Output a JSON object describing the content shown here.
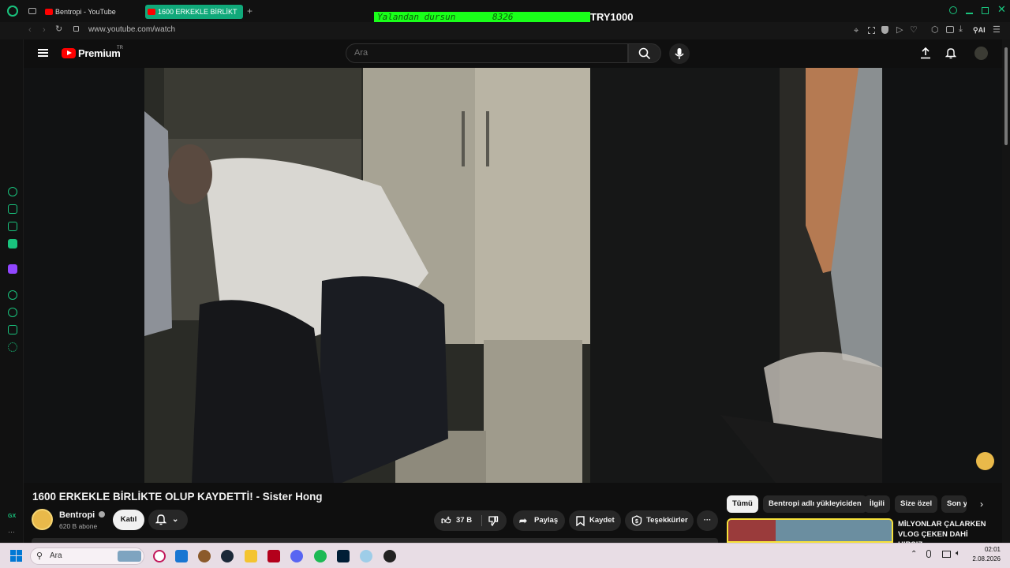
{
  "browser": {
    "tabs": [
      {
        "label": "Bentropi - YouTube",
        "active": false
      },
      {
        "label": "1600 ERKEKLE BİRLİKT",
        "active": true
      }
    ],
    "new_tab_label": "+",
    "url": "www.youtube.com/watch",
    "ai_label": "AI",
    "overlay": {
      "text": "Yalandan dursun",
      "count": "8326",
      "goal": "TRY1000"
    },
    "accent": "#10a97a"
  },
  "sidebar": {
    "icons": [
      "refresh-icon",
      "robot-icon",
      "wallet-icon",
      "messenger-icon",
      "twitch-icon",
      "play-icon",
      "history-icon",
      "puzzle-icon",
      "settings-icon"
    ],
    "gx_label": "GX",
    "more_label": "···"
  },
  "youtube": {
    "brand": "Premium",
    "region": "TR",
    "search_placeholder": "Ara"
  },
  "video": {
    "title": "1600 ERKEKLE BİRLİKTE OLUP KAYDETTİ! - Sister Hong",
    "channel": "Bentropi",
    "verified": true,
    "subscribers": "620 B abone",
    "join_label": "Katıl",
    "likes": "37 B",
    "share_label": "Paylaş",
    "save_label": "Kaydet",
    "thanks_label": "Teşekkürler",
    "more_label": "···"
  },
  "related": {
    "chips": [
      "Tümü",
      "Bentropi adlı yükleyiciden",
      "İlgili",
      "Size özel",
      "Son y"
    ],
    "first_video_title": "MİLYONLAR ÇALARKEN VLOG ÇEKEN DAHİ HIRSIZ"
  },
  "taskbar": {
    "search_placeholder": "Ara",
    "time": "02:01",
    "date": "2.08.2026",
    "apps": [
      "opera-gx-icon",
      "store-icon",
      "game-icon",
      "steam-icon",
      "file-explorer-icon",
      "adobe-icon",
      "discord-icon",
      "spotify-icon",
      "photoshop-icon",
      "network-icon",
      "obs-icon"
    ]
  },
  "colors": {
    "youtube_red": "#ff0000",
    "overlay_green": "#1aff1a",
    "gx_green": "#19c37d"
  }
}
